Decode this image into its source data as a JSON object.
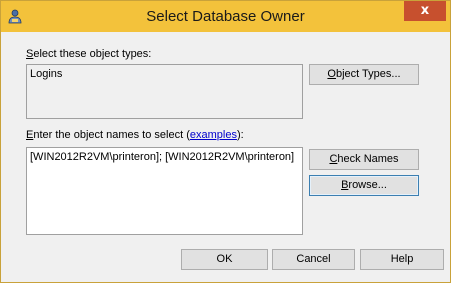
{
  "window": {
    "title": "Select Database Owner",
    "close_glyph": "x"
  },
  "object_types": {
    "label_accel": "S",
    "label_rest": "elect these object types:",
    "value": "Logins",
    "button_accel": "O",
    "button_rest": "bject Types..."
  },
  "object_names": {
    "label_accel": "E",
    "label_middle": "nter the object names to select (",
    "link_text": "examples",
    "label_end": "):",
    "value": "[WIN2012R2VM\\printeron]; [WIN2012R2VM\\printeron]"
  },
  "buttons": {
    "check_names_accel": "C",
    "check_names_rest": "heck Names",
    "browse_accel": "B",
    "browse_rest": "rowse...",
    "ok": "OK",
    "cancel": "Cancel",
    "help": "Help"
  },
  "colors": {
    "titlebar": "#f3c23b",
    "close": "#c7502e",
    "link": "#0000cc"
  }
}
